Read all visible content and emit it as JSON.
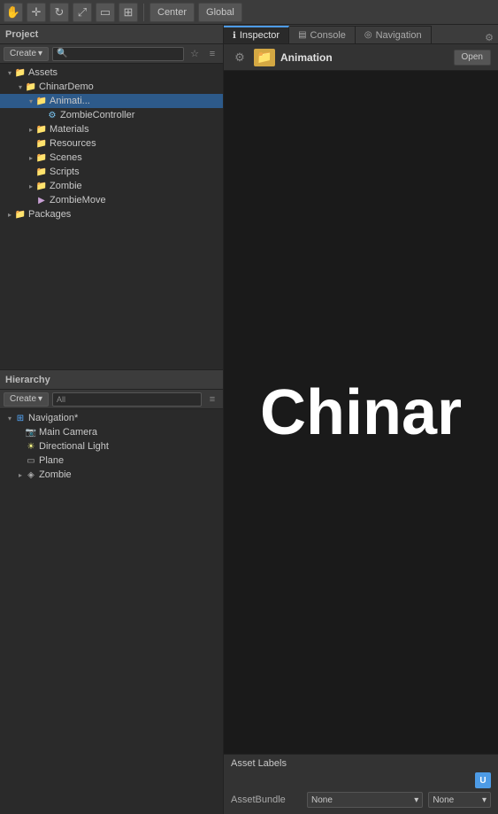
{
  "toolbar": {
    "icons": [
      "hand",
      "move",
      "refresh",
      "scale",
      "rect",
      "toggle"
    ],
    "center_label": "Center",
    "global_label": "Global"
  },
  "project_panel": {
    "title": "Project",
    "create_label": "Create",
    "search_placeholder": "",
    "assets": {
      "root": "Assets",
      "children": [
        {
          "name": "ChinarDemo",
          "type": "folder",
          "children": [
            {
              "name": "Animati...",
              "type": "folder",
              "selected": true,
              "children": [
                {
                  "name": "ZombieController",
                  "type": "script"
                }
              ]
            },
            {
              "name": "Materials",
              "type": "folder"
            },
            {
              "name": "Resources",
              "type": "folder"
            },
            {
              "name": "Scenes",
              "type": "folder"
            },
            {
              "name": "Scripts",
              "type": "folder"
            },
            {
              "name": "Zombie",
              "type": "folder"
            },
            {
              "name": "ZombieMove",
              "type": "script"
            }
          ]
        }
      ]
    },
    "packages": {
      "name": "Packages",
      "type": "folder"
    }
  },
  "hierarchy_panel": {
    "title": "Hierarchy",
    "create_label": "Create",
    "all_label": "All",
    "scene": {
      "name": "Navigation*",
      "items": [
        {
          "name": "Main Camera",
          "type": "camera"
        },
        {
          "name": "Directional Light",
          "type": "light"
        },
        {
          "name": "Plane",
          "type": "mesh"
        },
        {
          "name": "Zombie",
          "type": "object"
        }
      ]
    }
  },
  "tabs": [
    {
      "id": "inspector",
      "label": "Inspector",
      "active": true,
      "icon": "i"
    },
    {
      "id": "console",
      "label": "Console",
      "active": false,
      "icon": "c"
    },
    {
      "id": "navigation",
      "label": "Navigation",
      "active": false,
      "icon": "n"
    }
  ],
  "inspector": {
    "folder_name": "Animation",
    "open_button": "Open",
    "settings_icon": "⚙"
  },
  "game_view": {
    "text": "Chinar"
  },
  "asset_labels": {
    "title": "Asset Labels",
    "assetbundle_label": "AssetBundle",
    "none_option": "None",
    "none2_option": "None"
  }
}
